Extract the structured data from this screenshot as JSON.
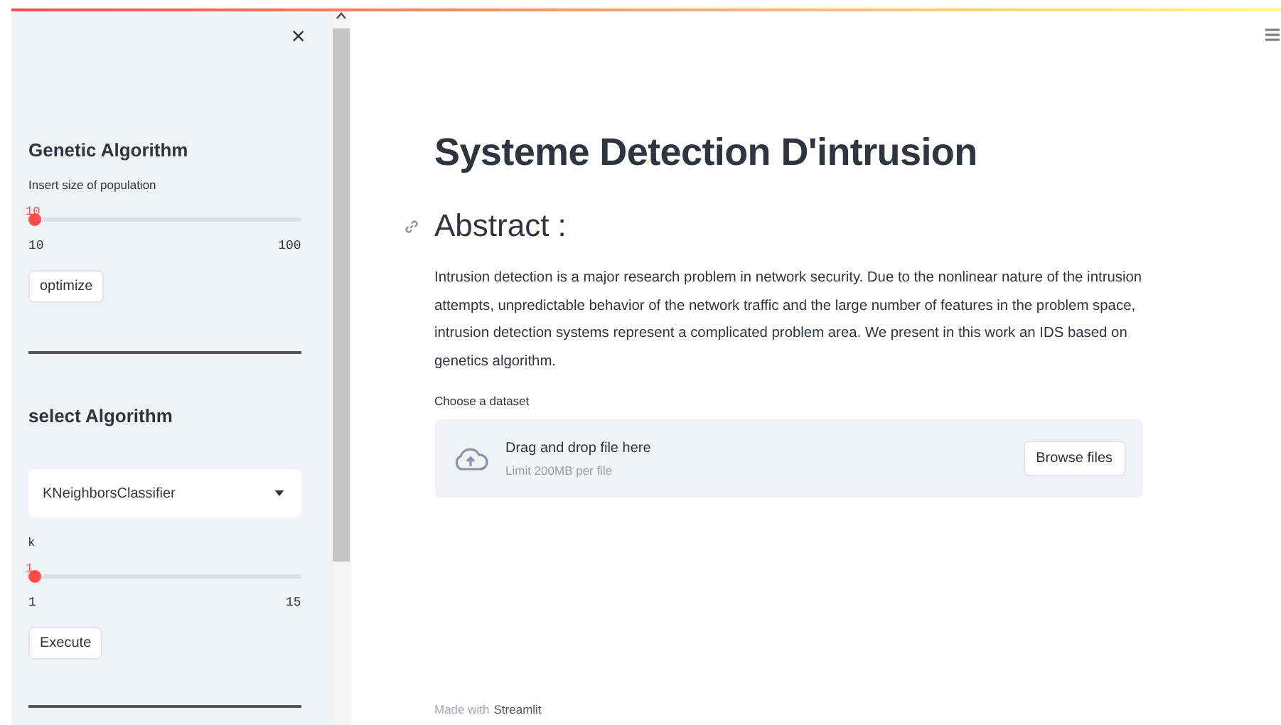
{
  "sidebar": {
    "close": "×",
    "sections": [
      {
        "heading": "Genetic Algorithm",
        "slider": {
          "label": "Insert size of population",
          "value": "10",
          "min": "10",
          "max": "100",
          "level": 0
        },
        "button": "optimize"
      },
      {
        "heading": "select Algorithm",
        "select": {
          "value": "KNeighborsClassifier"
        },
        "slider": {
          "label": "k",
          "value": "1",
          "min": "1",
          "max": "15",
          "level": 0
        },
        "button": "Execute"
      }
    ]
  },
  "main": {
    "title": "Systeme Detection D'intrusion",
    "subtitle": "Abstract :",
    "paragraph": "Intrusion detection is a major research problem in network security. Due to the nonlinear nature of the intrusion attempts, unpredictable behavior of the network traffic and the large number of features in the problem space, intrusion detection systems represent a complicated problem area. We present in this work an IDS based on genetics algorithm.",
    "uploader": {
      "label": "Choose a dataset",
      "prompt": "Drag and drop file here",
      "limit": "Limit 200MB per file",
      "button": "Browse files"
    },
    "footer": {
      "text": "Made with",
      "link": "Streamlit"
    }
  }
}
